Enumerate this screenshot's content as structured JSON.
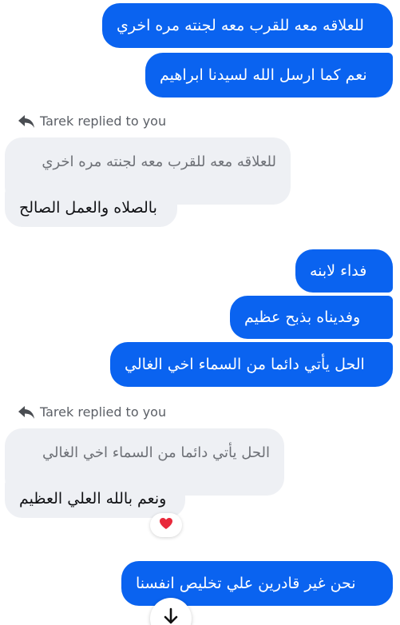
{
  "messages_top": [
    {
      "text": "للعلاقه معه للقرب معه لجنته مره اخري"
    },
    {
      "text": "نعم كما ارسل الله لسيدنا ابراهيم"
    }
  ],
  "reply1": {
    "label": "Tarek replied to you",
    "quoted": "للعلاقه معه للقرب معه لجنته مره اخري",
    "text": "بالصلاه والعمل الصالح"
  },
  "messages_mid": [
    {
      "text": "فداء لابنه"
    },
    {
      "text": "وفديناه بذبح عظيم"
    },
    {
      "text": "الحل يأتي دائما من السماء اخي الغالي"
    }
  ],
  "reply2": {
    "label": "Tarek replied to you",
    "quoted": "الحل يأتي دائما من السماء اخي الغالي",
    "text": "ونعم بالله العلي العظيم",
    "reaction": "❤️"
  },
  "messages_bottom": [
    {
      "text": "نحن غير قادرين علي تخليص انفسنا"
    }
  ],
  "icons": {
    "reply": "reply-arrow-icon",
    "heart": "heart-icon",
    "scroll": "arrow-down-icon"
  },
  "colors": {
    "outgoing": "#0a63f0",
    "incoming": "#eef0f4"
  }
}
